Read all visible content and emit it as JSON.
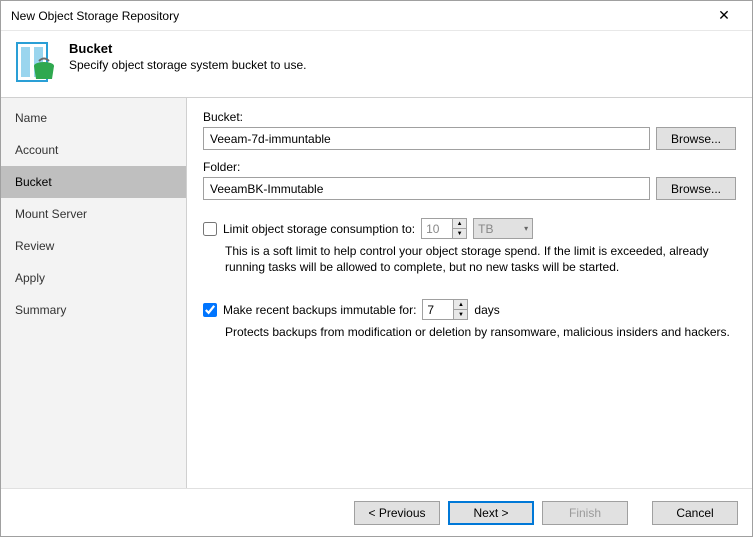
{
  "window": {
    "title": "New Object Storage Repository"
  },
  "header": {
    "title": "Bucket",
    "desc": "Specify object storage system bucket to use."
  },
  "sidebar": {
    "items": [
      {
        "label": "Name",
        "active": false
      },
      {
        "label": "Account",
        "active": false
      },
      {
        "label": "Bucket",
        "active": true
      },
      {
        "label": "Mount Server",
        "active": false
      },
      {
        "label": "Review",
        "active": false
      },
      {
        "label": "Apply",
        "active": false
      },
      {
        "label": "Summary",
        "active": false
      }
    ]
  },
  "form": {
    "bucket_label": "Bucket:",
    "bucket_value": "Veeam-7d-immuntable",
    "folder_label": "Folder:",
    "folder_value": "VeeamBK-Immutable",
    "browse_label": "Browse...",
    "limit_checked": false,
    "limit_label": "Limit object storage consumption to:",
    "limit_value": "10",
    "limit_unit": "TB",
    "limit_help": "This is a soft limit to help control your object storage spend. If the limit is exceeded, already running tasks will be allowed to complete, but no new tasks will be started.",
    "immut_checked": true,
    "immut_label": "Make recent backups immutable for:",
    "immut_value": "7",
    "immut_unit": "days",
    "immut_help": "Protects backups from modification or deletion by ransomware, malicious insiders and hackers."
  },
  "footer": {
    "previous": "< Previous",
    "next": "Next >",
    "finish": "Finish",
    "cancel": "Cancel"
  }
}
